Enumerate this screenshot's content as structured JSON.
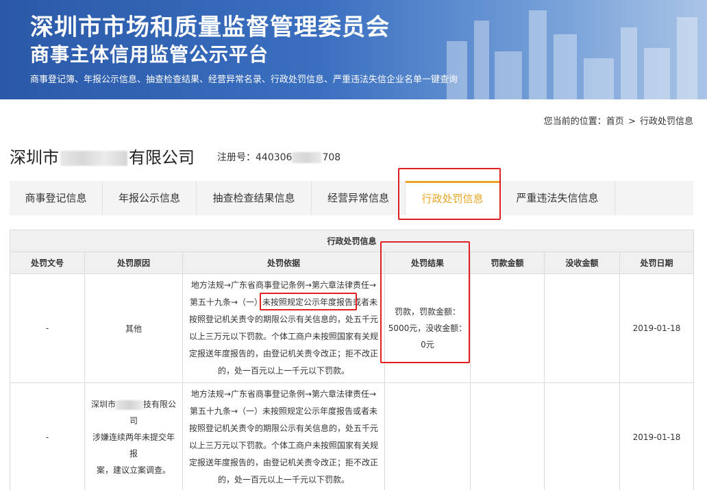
{
  "header": {
    "title": "深圳市市场和质量监督管理委员会",
    "subtitle": "商事主体信用监管公示平台",
    "tagline": "商事登记簿、年报公示信息、抽查检查结果、经营异常名录、行政处罚信息、严重违法失信企业名单一键查询"
  },
  "breadcrumb": {
    "prefix": "您当前的位置：",
    "home": "首页",
    "sep": ">",
    "current": "行政处罚信息"
  },
  "company": {
    "name_start": "深圳市",
    "name_end": "有限公司",
    "reg_label": "注册号：",
    "reg_start": "440306",
    "reg_end": "708"
  },
  "tabs": [
    {
      "label": "商事登记信息"
    },
    {
      "label": "年报公示信息"
    },
    {
      "label": "抽查检查结果信息"
    },
    {
      "label": "经营异常信息"
    },
    {
      "label": "行政处罚信息"
    },
    {
      "label": "严重违法失信信息"
    }
  ],
  "table": {
    "caption": "行政处罚信息",
    "columns": [
      "处罚文号",
      "处罚原因",
      "处罚依据",
      "处罚结果",
      "罚款金额",
      "没收金额",
      "处罚日期"
    ],
    "rows": [
      {
        "doc_no": "-",
        "reason": "其他",
        "basis_l1": "地方法规→广东省商事登记条例→第六章法律责任→",
        "basis_l2": "第五十九条→（一）未按照规定公示年度报告或者未",
        "basis_l3": "按照登记机关责令的期限公示有关信息的，处五千元",
        "basis_l4": "以上三万元以下罚款。个体工商户未按照国家有关规",
        "basis_l5": "定报送年度报告的，由登记机关责令改正；拒不改正",
        "basis_l6": "的，处一百元以上一千元以下罚款。",
        "result_l1": "罚款，罚款金额：",
        "result_l2": "5000元，没收金额：",
        "result_l3": "0元",
        "fine": "",
        "confiscated": "",
        "date": "2019-01-18"
      },
      {
        "doc_no": "-",
        "reason_l1_start": "深圳市",
        "reason_l1_end": "技有限公司",
        "reason_l2": "涉嫌连续两年未提交年报",
        "reason_l3": "案，建议立案调查。",
        "basis_l1": "地方法规→广东省商事登记条例→第六章法律责任→",
        "basis_l2": "第五十九条→（一）未按照规定公示年度报告或者未",
        "basis_l3": "按照登记机关责令的期限公示有关信息的，处五千元",
        "basis_l4": "以上三万元以下罚款。个体工商户未按照国家有关规",
        "basis_l5": "定报送年度报告的，由登记机关责令改正；拒不改正",
        "basis_l6": "的，处一百元以上一千元以下罚款。",
        "result": "",
        "fine": "",
        "confiscated": "",
        "date": "2019-01-18"
      }
    ]
  },
  "colors": {
    "banner": "#2b59a8",
    "active_tab": "#e7a523",
    "highlight_box": "#e02020"
  }
}
